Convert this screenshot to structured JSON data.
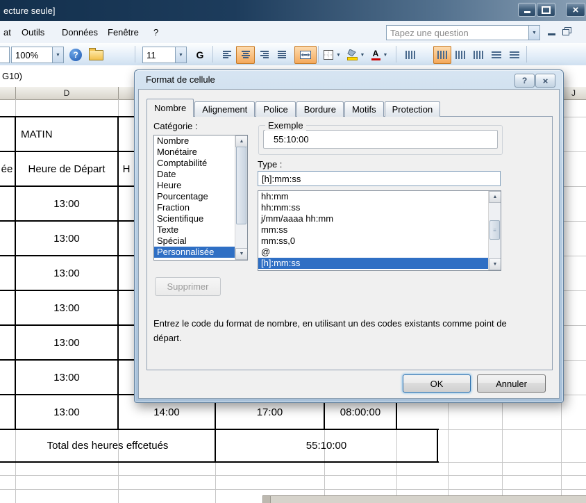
{
  "window": {
    "title": "ecture seule]"
  },
  "menu": {
    "items": [
      "at",
      "Outils",
      "Données",
      "Fenêtre",
      "?"
    ],
    "question_placeholder": "Tapez une question"
  },
  "toolbar": {
    "zoom": "100%",
    "font_size": "11",
    "bold_label": "G"
  },
  "formula_bar": {
    "text": "G10)"
  },
  "sheet": {
    "col_d": "D",
    "col_j": "J",
    "matin": "MATIN",
    "left_partial": "ée",
    "depart_header": "Heure de Départ",
    "right_partial": "H",
    "times": [
      "13:00",
      "13:00",
      "13:00",
      "13:00",
      "13:00",
      "13:00"
    ],
    "bottom_row": [
      "13:00",
      "14:00",
      "17:00",
      "08:00:00"
    ],
    "total_label": "Total des heures effcetués",
    "total_value": "55:10:00"
  },
  "dialog": {
    "title": "Format de cellule",
    "tabs": [
      "Nombre",
      "Alignement",
      "Police",
      "Bordure",
      "Motifs",
      "Protection"
    ],
    "category_label": "Catégorie :",
    "categories": [
      "Nombre",
      "Monétaire",
      "Comptabilité",
      "Date",
      "Heure",
      "Pourcentage",
      "Fraction",
      "Scientifique",
      "Texte",
      "Spécial",
      "Personnalisée"
    ],
    "selected_category": "Personnalisée",
    "example_label": "Exemple",
    "example_value": "55:10:00",
    "type_label": "Type :",
    "type_value": "[h]:mm:ss",
    "formats": [
      "hh:mm",
      "hh:mm:ss",
      "j/mm/aaaa hh:mm",
      "mm:ss",
      "mm:ss,0",
      "@",
      "[h]:mm:ss"
    ],
    "selected_format": "[h]:mm:ss",
    "delete_label": "Supprimer",
    "description": "Entrez le code du format de nombre, en utilisant un des codes existants comme point de départ.",
    "ok_label": "OK",
    "cancel_label": "Annuler"
  },
  "colors": {
    "selection_blue": "#2f6fc4",
    "active_orange": "#f5a95b",
    "titlebar_navy": "#1d3c5c"
  }
}
